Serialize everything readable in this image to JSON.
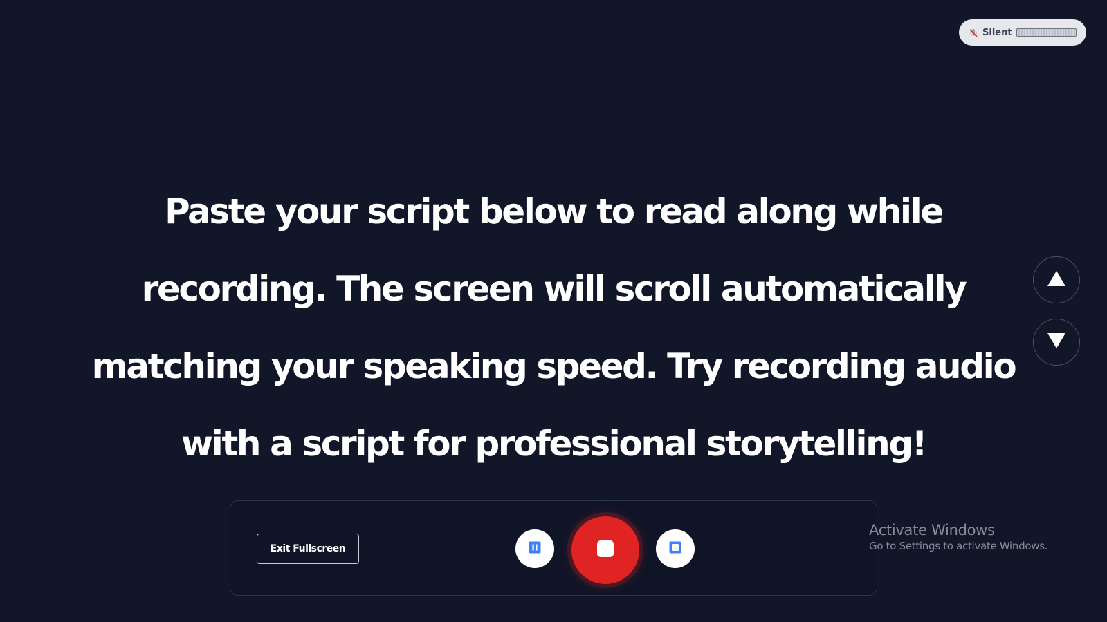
{
  "status_badge": {
    "label": "Silent",
    "icon": "muted-mic-icon",
    "level": 0
  },
  "script": {
    "text": "Paste your script below to read along while recording. The screen will scroll automatically matching your speaking speed. Try recording audio with a script for professional storytelling!"
  },
  "scroll_controls": {
    "up_icon": "triangle-up-icon",
    "down_icon": "triangle-down-icon"
  },
  "controls": {
    "exit_fullscreen_label": "Exit Fullscreen",
    "pause_icon": "pause-icon",
    "record_icon": "stop-icon",
    "stop_icon": "square-icon"
  },
  "watermark": {
    "title": "Activate Windows",
    "subtitle": "Go to Settings to activate Windows."
  },
  "colors": {
    "background": "#111729",
    "record": "#e02424",
    "accent_blue": "#3b82f6",
    "text": "#ffffff"
  }
}
